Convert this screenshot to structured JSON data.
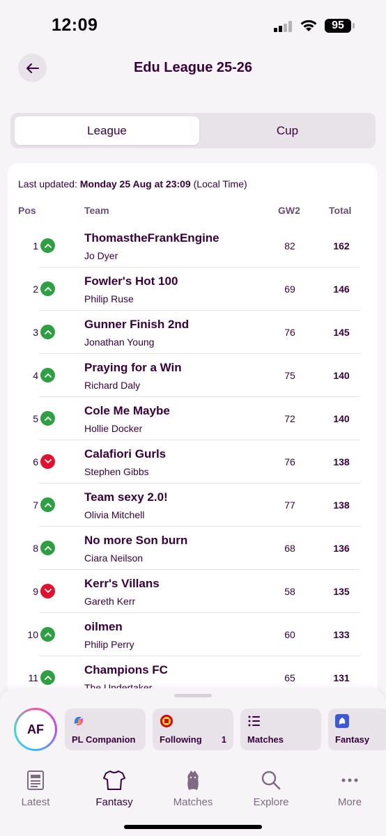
{
  "status_bar": {
    "time": "12:09",
    "battery": "95"
  },
  "header": {
    "title": "Edu League 25-26"
  },
  "segmented": {
    "league_label": "League",
    "cup_label": "Cup"
  },
  "table": {
    "last_updated_label": "Last updated:",
    "last_updated_value": "Monday 25 Aug at 23:09",
    "last_updated_suffix": "(Local Time)",
    "columns": {
      "pos": "Pos",
      "team": "Team",
      "gw": "GW2",
      "total": "Total"
    },
    "rows": [
      {
        "pos": "1",
        "move": "up",
        "team": "ThomastheFrankEngine",
        "manager": "Jo Dyer",
        "gw": "82",
        "total": "162"
      },
      {
        "pos": "2",
        "move": "up",
        "team": "Fowler's Hot 100",
        "manager": "Philip Ruse",
        "gw": "69",
        "total": "146"
      },
      {
        "pos": "3",
        "move": "up",
        "team": "Gunner Finish 2nd",
        "manager": "Jonathan Young",
        "gw": "76",
        "total": "145"
      },
      {
        "pos": "4",
        "move": "up",
        "team": "Praying for a Win",
        "manager": "Richard Daly",
        "gw": "75",
        "total": "140"
      },
      {
        "pos": "5",
        "move": "up",
        "team": "Cole Me Maybe",
        "manager": "Hollie Docker",
        "gw": "72",
        "total": "140"
      },
      {
        "pos": "6",
        "move": "down",
        "team": "Calafiori Gurls",
        "manager": "Stephen Gibbs",
        "gw": "76",
        "total": "138"
      },
      {
        "pos": "7",
        "move": "up",
        "team": "Team sexy 2.0!",
        "manager": "Olivia Mitchell",
        "gw": "77",
        "total": "138"
      },
      {
        "pos": "8",
        "move": "up",
        "team": "No more Son burn",
        "manager": "Ciara Neilson",
        "gw": "68",
        "total": "136"
      },
      {
        "pos": "9",
        "move": "down",
        "team": "Kerr's Villans",
        "manager": "Gareth Kerr",
        "gw": "58",
        "total": "135"
      },
      {
        "pos": "10",
        "move": "up",
        "team": "oilmen",
        "manager": "Philip Perry",
        "gw": "60",
        "total": "133"
      },
      {
        "pos": "11",
        "move": "up",
        "team": "Champions FC",
        "manager": "The Undertaker",
        "gw": "65",
        "total": "131"
      }
    ]
  },
  "bottom_sheet": {
    "avatar_initials": "AF",
    "chips": [
      {
        "label": "PL Companion",
        "icon": "copilot-icon"
      },
      {
        "label": "Following",
        "count": "1",
        "icon": "club-crest-icon"
      },
      {
        "label": "Matches",
        "icon": "list-icon"
      },
      {
        "label": "Fantasy",
        "icon": "fantasy-lion-icon"
      }
    ]
  },
  "tabbar": {
    "tabs": [
      {
        "label": "Latest",
        "icon": "newspaper-icon"
      },
      {
        "label": "Fantasy",
        "icon": "shirt-icon",
        "active": true
      },
      {
        "label": "Matches",
        "icon": "premier-league-lion-icon"
      },
      {
        "label": "Explore",
        "icon": "search-icon"
      },
      {
        "label": "More",
        "icon": "more-dots-icon"
      }
    ]
  },
  "colors": {
    "brand": "#37003c",
    "up": "#2ea043",
    "down": "#e1102f",
    "background": "#f6f4f7"
  }
}
